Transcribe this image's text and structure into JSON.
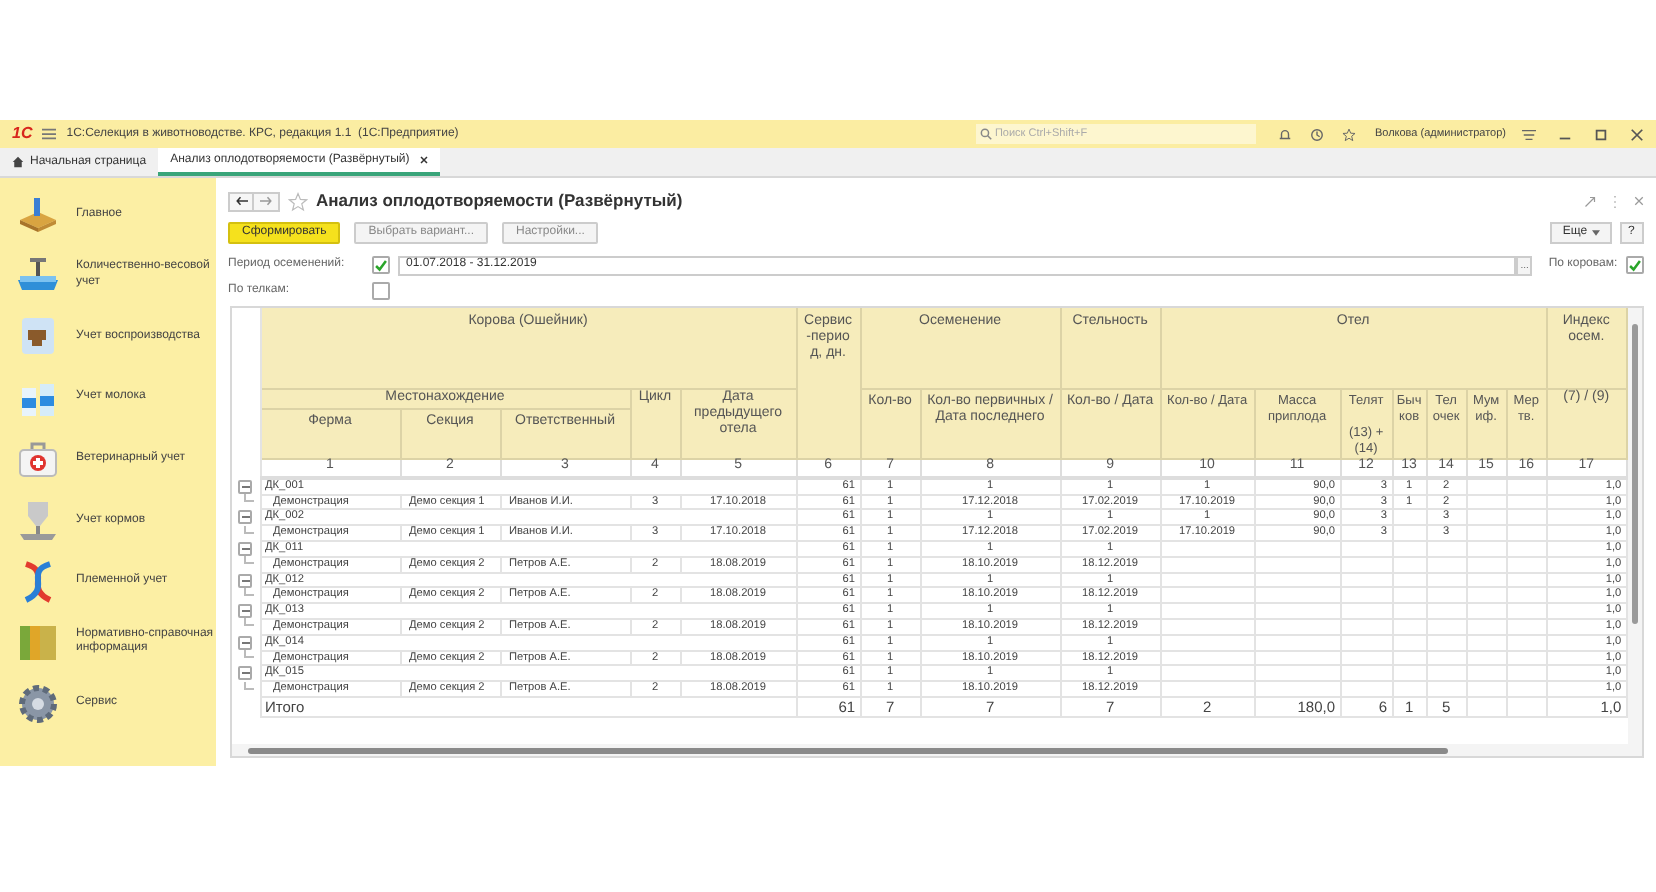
{
  "app": {
    "logo": "1С",
    "title": "1С:Селекция в животноводстве. КРС, редакция 1.1  (1С:Предприятие)",
    "search": {
      "placeholder": "Поиск Ctrl+Shift+F"
    },
    "user": "Волкова (администратор)"
  },
  "tabs": [
    {
      "label": "Начальная страница",
      "kind": "home",
      "selected": false
    },
    {
      "label": "Анализ оплодотворяемости (Развёрнутый)",
      "kind": "document",
      "selected": true
    }
  ],
  "sidebar": {
    "items": [
      {
        "label": "Главное"
      },
      {
        "label": "Количественно-весовой учет"
      },
      {
        "label": "Учет воспроизводства"
      },
      {
        "label": "Учет молока"
      },
      {
        "label": "Ветеринарный учет"
      },
      {
        "label": "Учет кормов"
      },
      {
        "label": "Племенной учет"
      },
      {
        "label": "Нормативно-справочная информация"
      },
      {
        "label": "Сервис"
      }
    ]
  },
  "form": {
    "title": "Анализ оплодотворяемости (Развёрнутый)",
    "buttons": [
      {
        "label": "Сформировать",
        "kind": "primary"
      },
      {
        "label": "Выбрать вариант...",
        "kind": "default"
      },
      {
        "label": "Настройки...",
        "kind": "default"
      }
    ],
    "more_button": "Еще",
    "help_button": "?",
    "period": {
      "label": "Период осеменений:",
      "checked": true,
      "value": "01.07.2018 - 31.12.2019",
      "choose_button": "..."
    },
    "by_cows": {
      "label": "По коровам:",
      "checked": true
    },
    "by_heifers": {
      "label": "По телкам:",
      "checked": false
    }
  },
  "report": {
    "header": {
      "cow": "Корова (Ошейник)",
      "location": "Местонахождение",
      "farm": "Ферма",
      "section": "Секция",
      "responsible": "Ответственный",
      "cycle": "Цикл",
      "prev_calving": "Дата предыдущего отела",
      "service_period": "Сервис -перио д, дн.",
      "insemination": "Осеменение",
      "insemination_columns": [
        "Кол-во",
        "Кол-во первичных / Дата последнего"
      ],
      "pregnancy": "Стельность",
      "pregnancy_columns": [
        "Кол-во / Дата"
      ],
      "calving": "Отел",
      "calving_columns": [
        "Кол-во / Дата",
        "Масса приплода",
        "Телят",
        "Быч ков",
        "Тел очек",
        "Мум иф.",
        "Мер тв."
      ],
      "calves_formula": "(13) + (14)",
      "index": "Индекс осем.",
      "index_formula": "(7) / (9)"
    },
    "column_numbers": [
      "1",
      "2",
      "3",
      "4",
      "5",
      "6",
      "7",
      "8",
      "9",
      "10",
      "11",
      "12",
      "13",
      "14",
      "15",
      "16",
      "17"
    ],
    "groups": [
      {
        "cow": "ДК_001",
        "expanded": true,
        "cells": [
          "61",
          "1",
          "1",
          "1",
          "1",
          "90,0",
          "3",
          "1",
          "2",
          null,
          null,
          "1,0"
        ],
        "children": [
          {
            "cells": [
              "Демонстрация",
              "Демо секция 1",
              "Иванов И.И.",
              "3",
              "17.10.2018",
              "61",
              "1",
              "17.12.2018",
              "17.02.2019",
              "17.10.2019",
              "90,0",
              "3",
              "1",
              "2",
              null,
              null,
              "1,0"
            ]
          }
        ]
      },
      {
        "cow": "ДК_002",
        "expanded": true,
        "cells": [
          "61",
          "1",
          "1",
          "1",
          "1",
          "90,0",
          "3",
          null,
          "3",
          null,
          null,
          "1,0"
        ],
        "children": [
          {
            "cells": [
              "Демонстрация",
              "Демо секция 1",
              "Иванов И.И.",
              "3",
              "17.10.2018",
              "61",
              "1",
              "17.12.2018",
              "17.02.2019",
              "17.10.2019",
              "90,0",
              "3",
              null,
              "3",
              null,
              null,
              "1,0"
            ]
          }
        ]
      },
      {
        "cow": "ДК_011",
        "expanded": true,
        "cells": [
          "61",
          "1",
          "1",
          "1",
          null,
          null,
          null,
          null,
          null,
          null,
          null,
          "1,0"
        ],
        "children": [
          {
            "cells": [
              "Демонстрация",
              "Демо секция 2",
              "Петров А.Е.",
              "2",
              "18.08.2019",
              "61",
              "1",
              "18.10.2019",
              "18.12.2019",
              null,
              null,
              null,
              null,
              null,
              null,
              null,
              "1,0"
            ]
          }
        ]
      },
      {
        "cow": "ДК_012",
        "expanded": true,
        "cells": [
          "61",
          "1",
          "1",
          "1",
          null,
          null,
          null,
          null,
          null,
          null,
          null,
          "1,0"
        ],
        "children": [
          {
            "cells": [
              "Демонстрация",
              "Демо секция 2",
              "Петров А.Е.",
              "2",
              "18.08.2019",
              "61",
              "1",
              "18.10.2019",
              "18.12.2019",
              null,
              null,
              null,
              null,
              null,
              null,
              null,
              "1,0"
            ]
          }
        ]
      },
      {
        "cow": "ДК_013",
        "expanded": true,
        "cells": [
          "61",
          "1",
          "1",
          "1",
          null,
          null,
          null,
          null,
          null,
          null,
          null,
          "1,0"
        ],
        "children": [
          {
            "cells": [
              "Демонстрация",
              "Демо секция 2",
              "Петров А.Е.",
              "2",
              "18.08.2019",
              "61",
              "1",
              "18.10.2019",
              "18.12.2019",
              null,
              null,
              null,
              null,
              null,
              null,
              null,
              "1,0"
            ]
          }
        ]
      },
      {
        "cow": "ДК_014",
        "expanded": true,
        "cells": [
          "61",
          "1",
          "1",
          "1",
          null,
          null,
          null,
          null,
          null,
          null,
          null,
          "1,0"
        ],
        "children": [
          {
            "cells": [
              "Демонстрация",
              "Демо секция 2",
              "Петров А.Е.",
              "2",
              "18.08.2019",
              "61",
              "1",
              "18.10.2019",
              "18.12.2019",
              null,
              null,
              null,
              null,
              null,
              null,
              null,
              "1,0"
            ]
          }
        ]
      },
      {
        "cow": "ДК_015",
        "expanded": true,
        "cells": [
          "61",
          "1",
          "1",
          "1",
          null,
          null,
          null,
          null,
          null,
          null,
          null,
          "1,0"
        ],
        "children": [
          {
            "cells": [
              "Демонстрация",
              "Демо секция 2",
              "Петров А.Е.",
              "2",
              "18.08.2019",
              "61",
              "1",
              "18.10.2019",
              "18.12.2019",
              null,
              null,
              null,
              null,
              null,
              null,
              null,
              "1,0"
            ]
          }
        ]
      }
    ],
    "total": {
      "label": "Итого",
      "cells": [
        "61",
        "7",
        "7",
        "7",
        "2",
        "180,0",
        "6",
        "1",
        "5",
        null,
        null,
        "1,0"
      ]
    }
  }
}
